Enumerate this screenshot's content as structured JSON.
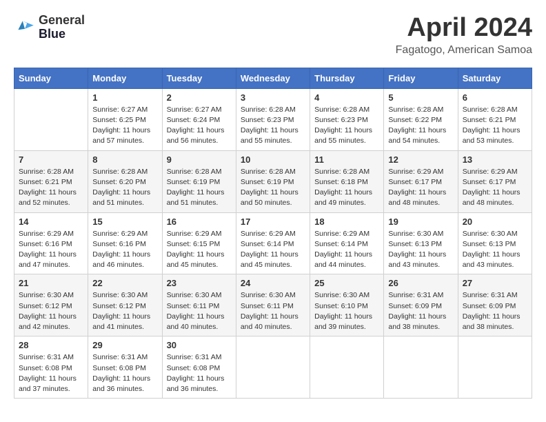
{
  "header": {
    "logo_line1": "General",
    "logo_line2": "Blue",
    "month": "April 2024",
    "location": "Fagatogo, American Samoa"
  },
  "weekdays": [
    "Sunday",
    "Monday",
    "Tuesday",
    "Wednesday",
    "Thursday",
    "Friday",
    "Saturday"
  ],
  "weeks": [
    [
      {
        "day": "",
        "info": ""
      },
      {
        "day": "1",
        "info": "Sunrise: 6:27 AM\nSunset: 6:25 PM\nDaylight: 11 hours\nand 57 minutes."
      },
      {
        "day": "2",
        "info": "Sunrise: 6:27 AM\nSunset: 6:24 PM\nDaylight: 11 hours\nand 56 minutes."
      },
      {
        "day": "3",
        "info": "Sunrise: 6:28 AM\nSunset: 6:23 PM\nDaylight: 11 hours\nand 55 minutes."
      },
      {
        "day": "4",
        "info": "Sunrise: 6:28 AM\nSunset: 6:23 PM\nDaylight: 11 hours\nand 55 minutes."
      },
      {
        "day": "5",
        "info": "Sunrise: 6:28 AM\nSunset: 6:22 PM\nDaylight: 11 hours\nand 54 minutes."
      },
      {
        "day": "6",
        "info": "Sunrise: 6:28 AM\nSunset: 6:21 PM\nDaylight: 11 hours\nand 53 minutes."
      }
    ],
    [
      {
        "day": "7",
        "info": "Sunrise: 6:28 AM\nSunset: 6:21 PM\nDaylight: 11 hours\nand 52 minutes."
      },
      {
        "day": "8",
        "info": "Sunrise: 6:28 AM\nSunset: 6:20 PM\nDaylight: 11 hours\nand 51 minutes."
      },
      {
        "day": "9",
        "info": "Sunrise: 6:28 AM\nSunset: 6:19 PM\nDaylight: 11 hours\nand 51 minutes."
      },
      {
        "day": "10",
        "info": "Sunrise: 6:28 AM\nSunset: 6:19 PM\nDaylight: 11 hours\nand 50 minutes."
      },
      {
        "day": "11",
        "info": "Sunrise: 6:28 AM\nSunset: 6:18 PM\nDaylight: 11 hours\nand 49 minutes."
      },
      {
        "day": "12",
        "info": "Sunrise: 6:29 AM\nSunset: 6:17 PM\nDaylight: 11 hours\nand 48 minutes."
      },
      {
        "day": "13",
        "info": "Sunrise: 6:29 AM\nSunset: 6:17 PM\nDaylight: 11 hours\nand 48 minutes."
      }
    ],
    [
      {
        "day": "14",
        "info": "Sunrise: 6:29 AM\nSunset: 6:16 PM\nDaylight: 11 hours\nand 47 minutes."
      },
      {
        "day": "15",
        "info": "Sunrise: 6:29 AM\nSunset: 6:16 PM\nDaylight: 11 hours\nand 46 minutes."
      },
      {
        "day": "16",
        "info": "Sunrise: 6:29 AM\nSunset: 6:15 PM\nDaylight: 11 hours\nand 45 minutes."
      },
      {
        "day": "17",
        "info": "Sunrise: 6:29 AM\nSunset: 6:14 PM\nDaylight: 11 hours\nand 45 minutes."
      },
      {
        "day": "18",
        "info": "Sunrise: 6:29 AM\nSunset: 6:14 PM\nDaylight: 11 hours\nand 44 minutes."
      },
      {
        "day": "19",
        "info": "Sunrise: 6:30 AM\nSunset: 6:13 PM\nDaylight: 11 hours\nand 43 minutes."
      },
      {
        "day": "20",
        "info": "Sunrise: 6:30 AM\nSunset: 6:13 PM\nDaylight: 11 hours\nand 43 minutes."
      }
    ],
    [
      {
        "day": "21",
        "info": "Sunrise: 6:30 AM\nSunset: 6:12 PM\nDaylight: 11 hours\nand 42 minutes."
      },
      {
        "day": "22",
        "info": "Sunrise: 6:30 AM\nSunset: 6:12 PM\nDaylight: 11 hours\nand 41 minutes."
      },
      {
        "day": "23",
        "info": "Sunrise: 6:30 AM\nSunset: 6:11 PM\nDaylight: 11 hours\nand 40 minutes."
      },
      {
        "day": "24",
        "info": "Sunrise: 6:30 AM\nSunset: 6:11 PM\nDaylight: 11 hours\nand 40 minutes."
      },
      {
        "day": "25",
        "info": "Sunrise: 6:30 AM\nSunset: 6:10 PM\nDaylight: 11 hours\nand 39 minutes."
      },
      {
        "day": "26",
        "info": "Sunrise: 6:31 AM\nSunset: 6:09 PM\nDaylight: 11 hours\nand 38 minutes."
      },
      {
        "day": "27",
        "info": "Sunrise: 6:31 AM\nSunset: 6:09 PM\nDaylight: 11 hours\nand 38 minutes."
      }
    ],
    [
      {
        "day": "28",
        "info": "Sunrise: 6:31 AM\nSunset: 6:08 PM\nDaylight: 11 hours\nand 37 minutes."
      },
      {
        "day": "29",
        "info": "Sunrise: 6:31 AM\nSunset: 6:08 PM\nDaylight: 11 hours\nand 36 minutes."
      },
      {
        "day": "30",
        "info": "Sunrise: 6:31 AM\nSunset: 6:08 PM\nDaylight: 11 hours\nand 36 minutes."
      },
      {
        "day": "",
        "info": ""
      },
      {
        "day": "",
        "info": ""
      },
      {
        "day": "",
        "info": ""
      },
      {
        "day": "",
        "info": ""
      }
    ]
  ]
}
